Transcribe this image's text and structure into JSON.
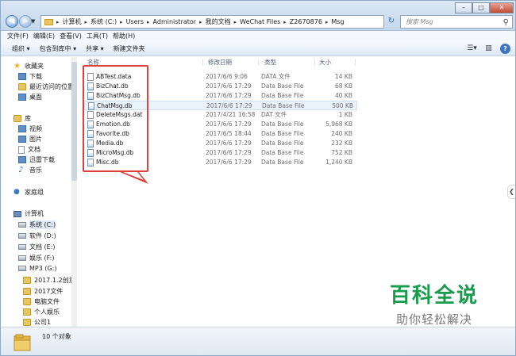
{
  "address": {
    "crumbs": [
      "计算机",
      "系统 (C:)",
      "Users",
      "Administrator",
      "我的文档",
      "WeChat Files",
      "Z2670876",
      "Msg"
    ]
  },
  "search": {
    "placeholder": "搜索 Msg"
  },
  "window_buttons": [
    "minimize-icon",
    "maximize-icon",
    "close-icon"
  ],
  "menu": [
    "文件(F)",
    "编辑(E)",
    "查看(V)",
    "工具(T)",
    "帮助(H)"
  ],
  "commands": [
    "组织 ▾",
    "包含到库中 ▾",
    "共享 ▾",
    "新建文件夹"
  ],
  "sidebar": {
    "favorites": {
      "label": "收藏夹",
      "items": [
        "下载",
        "最近访问的位置",
        "桌面"
      ]
    },
    "libraries": {
      "label": "库",
      "items": [
        "视频",
        "图片",
        "文档",
        "迅雷下载",
        "音乐"
      ]
    },
    "homegroup": "家庭组",
    "computer": {
      "label": "计算机",
      "items": [
        "系统 (C:)",
        "软件 (D:)",
        "文档 (E:)",
        "娱乐 (F:)",
        "MP3 (G:)"
      ],
      "mp3_children": [
        "2017.1.2创意图",
        "2017文件",
        "电脑文件",
        "个人娱乐",
        "公司1"
      ]
    }
  },
  "columns": {
    "name": "名称",
    "date": "修改日期",
    "type": "类型",
    "size": "大小"
  },
  "files": [
    {
      "name": "ABTest.data",
      "date": "2017/6/6 9:06",
      "type": "DATA 文件",
      "size": "14 KB",
      "icon": "file-icon"
    },
    {
      "name": "BizChat.db",
      "date": "2017/6/6 17:29",
      "type": "Data Base File",
      "size": "68 KB",
      "icon": "db-icon"
    },
    {
      "name": "BizChatMsg.db",
      "date": "2017/6/6 17:29",
      "type": "Data Base File",
      "size": "40 KB",
      "icon": "db-icon"
    },
    {
      "name": "ChatMsg.db",
      "date": "2017/6/6 17:29",
      "type": "Data Base File",
      "size": "500 KB",
      "icon": "db-icon"
    },
    {
      "name": "DeleteMsgs.dat",
      "date": "2017/4/21 16:58",
      "type": "DAT 文件",
      "size": "1 KB",
      "icon": "file-icon"
    },
    {
      "name": "Emotion.db",
      "date": "2017/6/6 17:29",
      "type": "Data Base File",
      "size": "5,968 KB",
      "icon": "db-icon"
    },
    {
      "name": "Favorite.db",
      "date": "2017/6/5 18:44",
      "type": "Data Base File",
      "size": "240 KB",
      "icon": "db-icon"
    },
    {
      "name": "Media.db",
      "date": "2017/6/6 17:29",
      "type": "Data Base File",
      "size": "232 KB",
      "icon": "db-icon"
    },
    {
      "name": "MicroMsg.db",
      "date": "2017/6/6 17:29",
      "type": "Data Base File",
      "size": "752 KB",
      "icon": "db-icon"
    },
    {
      "name": "Misc.db",
      "date": "2017/6/6 17:29",
      "type": "Data Base File",
      "size": "1,240 KB",
      "icon": "db-icon"
    }
  ],
  "status": {
    "count": "10 个对象"
  },
  "watermark": {
    "title": "百科全说",
    "subtitle": "助你轻松解决"
  },
  "colors": {
    "highlight_red": "#e0403c",
    "watermark_green": "#1a9a4b"
  }
}
